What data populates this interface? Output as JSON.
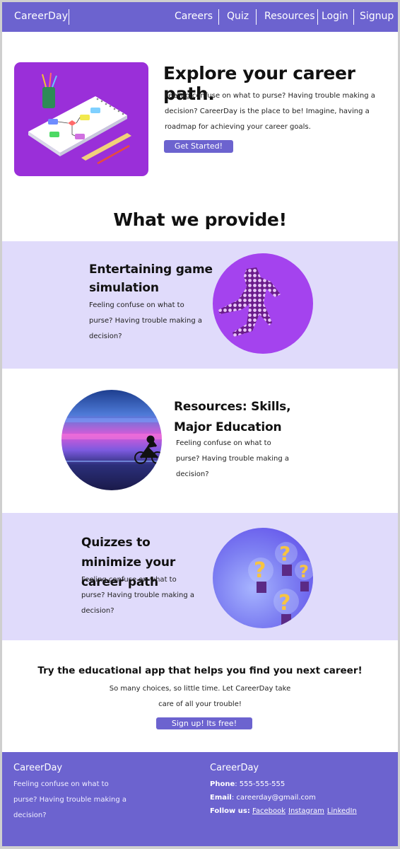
{
  "nav": {
    "brand": "CareerDay",
    "links": [
      "Careers",
      "Quiz",
      "Resources",
      "Login",
      "Signup"
    ]
  },
  "hero": {
    "title": "Explore your career path.",
    "text": "Feeling confuse on what to purse? Having trouble making a decision? CareerDay is the place to be! Imagine,  having a roadmap for achieving your career goals.",
    "button": "Get Started!"
  },
  "provide": {
    "title": "What we provide!",
    "sections": [
      {
        "title": "Entertaining game simulation",
        "text": "Feeling confuse on what to purse? Having trouble making a decision?"
      },
      {
        "title": "Resources: Skills, Major Education",
        "text": "Feeling confuse on what to purse? Having trouble making a decision?"
      },
      {
        "title": "Quizzes to minimize your career path",
        "text": "Feeling confuse on what to purse? Having trouble making a decision?"
      }
    ]
  },
  "cta": {
    "title": "Try the educational app that helps you find you next career!",
    "text": "So many choices, so little time. Let CareerDay take care of all your trouble!",
    "button": "Sign up! Its free!"
  },
  "footer": {
    "left": {
      "brand": "CareerDay",
      "text": "Feeling confuse on what to purse? Having trouble making a decision?"
    },
    "right": {
      "brand": "CareerDay",
      "phone_label": "Phone",
      "phone": ": 555-555-555",
      "email_label": "Email",
      "email": ": careerday@gmail.com",
      "follow_label": "Follow us:",
      "links": [
        "Facebook",
        "Instagram",
        "LinkedIn"
      ]
    }
  },
  "colors": {
    "accent": "#6c63cf",
    "lavender": "#e0dbfb",
    "hero_bg": "#9a2fd9"
  }
}
